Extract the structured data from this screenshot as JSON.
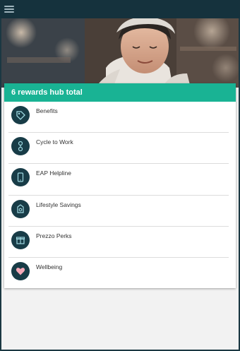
{
  "topbar": {
    "menu_icon": "hamburger-menu-icon"
  },
  "hero": {
    "image": "smiling-man-in-cap"
  },
  "card": {
    "title": "6 rewards hub total",
    "header_color": "#19b394",
    "items": [
      {
        "label": "Benefits",
        "icon": "tag-icon"
      },
      {
        "label": "Cycle to Work",
        "icon": "bicycle-icon"
      },
      {
        "label": "EAP Helpline",
        "icon": "phone-icon"
      },
      {
        "label": "Lifestyle Savings",
        "icon": "wallet-icon"
      },
      {
        "label": "Prezzo Perks",
        "icon": "gift-icon"
      },
      {
        "label": "Wellbeing",
        "icon": "heart-icon"
      }
    ]
  },
  "colors": {
    "topbar": "#15323d",
    "icon_badge": "#183c47"
  }
}
